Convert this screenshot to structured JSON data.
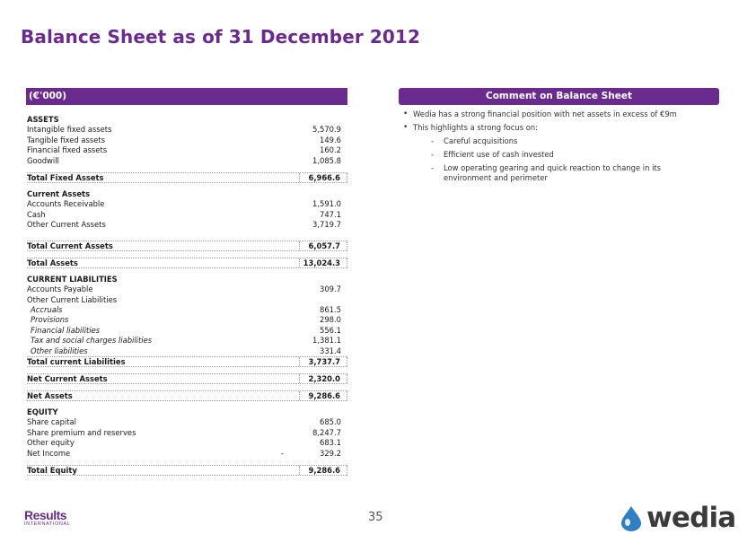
{
  "page": {
    "title": "Balance Sheet as of 31 December 2012",
    "page_number": "35"
  },
  "balance_sheet": {
    "header": "(€'000)",
    "rows": [
      {
        "type": "sec",
        "label": "ASSETS",
        "value": ""
      },
      {
        "type": "row",
        "label": "Intangible fixed assets",
        "value": "5,570.9"
      },
      {
        "type": "row",
        "label": "Tangible fixed assets",
        "value": "149.6"
      },
      {
        "type": "row",
        "label": "Financial fixed assets",
        "value": "160.2"
      },
      {
        "type": "row",
        "label": "Goodwill",
        "value": "1,085.8"
      },
      {
        "type": "gap-s"
      },
      {
        "type": "total",
        "label": "Total Fixed Assets",
        "value": "6,966.6"
      },
      {
        "type": "gap-s"
      },
      {
        "type": "sec",
        "label": "Current Assets",
        "value": ""
      },
      {
        "type": "row",
        "label": "Accounts Receivable",
        "value": "1,591.0"
      },
      {
        "type": "row",
        "label": "Cash",
        "value": "747.1"
      },
      {
        "type": "row",
        "label": "Other Current Assets",
        "value": "3,719.7"
      },
      {
        "type": "gap"
      },
      {
        "type": "total",
        "label": "Total Current Assets",
        "value": "6,057.7"
      },
      {
        "type": "gap-s"
      },
      {
        "type": "total",
        "label": "Total Assets",
        "value": "13,024.3"
      },
      {
        "type": "gap-s"
      },
      {
        "type": "sec",
        "label": "CURRENT LIABILITIES",
        "value": ""
      },
      {
        "type": "row",
        "label": "Accounts Payable",
        "value": "309.7"
      },
      {
        "type": "row",
        "label": "Other Current Liabilities",
        "value": ""
      },
      {
        "type": "ital",
        "label": "Accruals",
        "value": "861.5"
      },
      {
        "type": "ital",
        "label": "Provisions",
        "value": "298.0"
      },
      {
        "type": "ital",
        "label": "Financial liabilities",
        "value": "556.1"
      },
      {
        "type": "ital",
        "label": "Tax and social charges liabilities",
        "value": "1,381.1"
      },
      {
        "type": "ital",
        "label": "Other liabilities",
        "value": "331.4"
      },
      {
        "type": "total",
        "label": "Total current Liabilities",
        "value": "3,737.7"
      },
      {
        "type": "gap-s"
      },
      {
        "type": "total",
        "label": "Net Current Assets",
        "value": "2,320.0"
      },
      {
        "type": "gap-s"
      },
      {
        "type": "total",
        "label": "Net Assets",
        "value": "9,286.6"
      },
      {
        "type": "gap-s"
      },
      {
        "type": "sec",
        "label": "EQUITY",
        "value": ""
      },
      {
        "type": "row",
        "label": "Share capital",
        "value": "685.0"
      },
      {
        "type": "row",
        "label": "Share premium and reserves",
        "value": "8,247.7"
      },
      {
        "type": "row",
        "label": "Other equity",
        "value": "683.1"
      },
      {
        "type": "row",
        "label": "Net Income",
        "value": "329.2",
        "minus": "-"
      },
      {
        "type": "gap-s"
      },
      {
        "type": "total",
        "label": "Total Equity",
        "value": "9,286.6"
      }
    ]
  },
  "comment": {
    "header": "Comment on Balance Sheet",
    "bullets": [
      {
        "text": "Wedia has a strong financial position with net assets in excess of €9m",
        "subs": []
      },
      {
        "text": "This highlights a strong focus on:",
        "subs": [
          "Careful acquisitions",
          "Efficient use of cash invested",
          "Low operating gearing and quick reaction to change in its environment and perimeter"
        ]
      }
    ]
  },
  "logos": {
    "left_main": "Results",
    "left_sub": "INTERNATIONAL",
    "right": "wedia"
  },
  "colors": {
    "accent": "#6a2a8e",
    "drop": "#2f7fc1"
  }
}
